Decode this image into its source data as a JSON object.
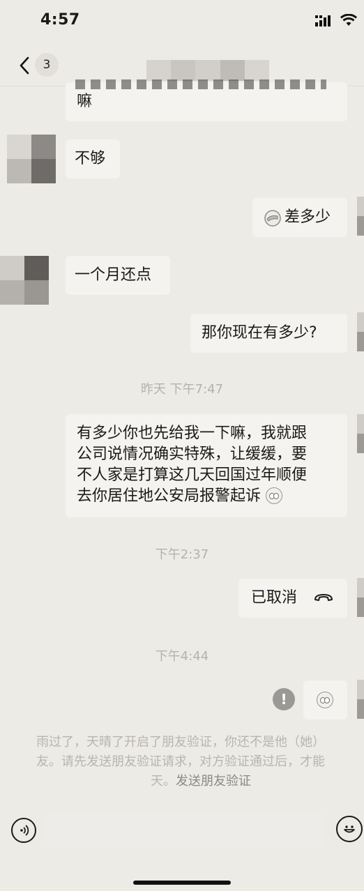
{
  "status_bar": {
    "time": "4:57"
  },
  "header": {
    "unread_count": "3"
  },
  "messages": {
    "m0": {
      "text": "嘛"
    },
    "m1": {
      "text": "不够"
    },
    "m2": {
      "text": "差多少"
    },
    "m3": {
      "text": "一个月还点"
    },
    "m4": {
      "text": "那你现在有多少?"
    },
    "t1": {
      "text": "昨天 下午7:47"
    },
    "m5": {
      "lines": [
        "有多少你也先给我一下嘛，我就跟",
        "公司说情况确实特殊，让缓缓，要",
        "不人家是打算这几天回国过年顺便",
        "去你居住地公安局报警起诉"
      ]
    },
    "t2": {
      "text": "下午2:37"
    },
    "m6": {
      "text": "已取消"
    },
    "t3": {
      "text": "下午4:44"
    }
  },
  "system_notice": {
    "line1": "雨过了，天晴了开启了朋友验证，你还不是他（她）",
    "line2": "友。请先发送朋友验证请求，对方验证通过后，才能",
    "line3_prefix": "天。",
    "line3_link": "发送朋友验证"
  },
  "colors": {
    "background": "#EDEBE6",
    "bubble": "#F5F3EF",
    "muted_text": "#B5B2AC"
  },
  "icons": {
    "back": "chevron-left-icon",
    "signal": "signal-icon",
    "wifi": "wifi-icon",
    "hangup": "phone-hangup-icon",
    "error": "exclamation-icon",
    "voice": "voice-icon",
    "emoji": "emoji-icon",
    "emoji_inline": "eye-roll-emoji"
  }
}
